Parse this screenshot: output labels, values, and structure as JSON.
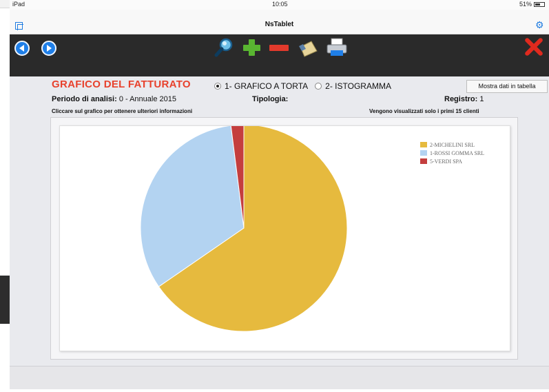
{
  "status_bar": {
    "device": "iPad",
    "time": "10:05",
    "battery": "51%"
  },
  "window": {
    "title": "NsTablet"
  },
  "toolbar": {
    "icons": [
      "back-icon",
      "forward-icon",
      "search-icon",
      "add-icon",
      "remove-icon",
      "edit-icon",
      "print-icon",
      "close-icon"
    ]
  },
  "header": {
    "title": "GRAFICO DEL FATTURATO",
    "radio_options": [
      {
        "label": "1- GRAFICO A TORTA",
        "checked": true
      },
      {
        "label": "2- ISTOGRAMMA",
        "checked": false
      }
    ],
    "table_button": "Mostra dati in tabella"
  },
  "info": {
    "period_label": "Periodo di analisi:",
    "period_value": "0 - Annuale 2015",
    "type_label": "Tipologia:",
    "register_label": "Registro:",
    "register_value": "1",
    "hint_left": "Cliccare sul grafico per ottenere ulteriori informazioni",
    "hint_right": "Vengono visualizzati solo i primi 15 clienti"
  },
  "chart_data": {
    "type": "pie",
    "title": "",
    "categories": [
      "2-MICHELINI SRL",
      "1-ROSSI GOMMA SRL",
      "5-VERDI SPA"
    ],
    "values": [
      65.4,
      32.6,
      2.0
    ],
    "colors": [
      "#e6ba3e",
      "#b3d3f1",
      "#c43e3e"
    ],
    "legend": "top-right"
  },
  "colors": {
    "accent": "#e8412c",
    "toolbar": "#2a2a2a",
    "nav": "#1f7fe8"
  }
}
